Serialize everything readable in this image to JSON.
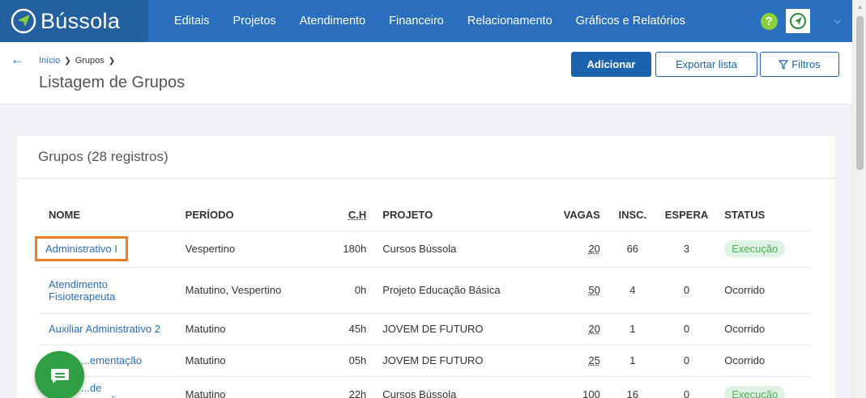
{
  "brand": {
    "name": "Bússola"
  },
  "nav": {
    "items": [
      "Editais",
      "Projetos",
      "Atendimento",
      "Financeiro",
      "Relacionamento",
      "Gráficos e Relatórios"
    ]
  },
  "header": {
    "breadcrumb": [
      "Início",
      "Grupos"
    ],
    "title": "Listagem de Grupos",
    "add_label": "Adicionar",
    "export_label": "Exportar lista",
    "filter_label": "Filtros"
  },
  "card": {
    "title": "Grupos (28 registros)"
  },
  "table": {
    "columns": [
      "NOME",
      "PERÍODO",
      "C.H",
      "PROJETO",
      "VAGAS",
      "INSC.",
      "ESPERA",
      "STATUS"
    ],
    "rows": [
      {
        "nome": "Administrativo I",
        "periodo": "Vespertino",
        "ch": "180h",
        "projeto": "Cursos Bússola",
        "vagas": "20",
        "insc": "66",
        "espera": "3",
        "status": "Execução"
      },
      {
        "nome": "Atendimento Fisioterapeuta",
        "periodo": "Matutino, Vespertino",
        "ch": "0h",
        "projeto": "Projeto Educação Básica",
        "vagas": "50",
        "insc": "4",
        "espera": "0",
        "status": "Ocorrido"
      },
      {
        "nome": "Auxiliar Administrativo 2",
        "periodo": "Matutino",
        "ch": "45h",
        "projeto": "JOVEM DE FUTURO",
        "vagas": "20",
        "insc": "1",
        "espera": "0",
        "status": "Ocorrido"
      },
      {
        "nome": "...ementação",
        "periodo": "Matutino",
        "ch": "05h",
        "projeto": "JOVEM DE FUTURO",
        "vagas": "25",
        "insc": "1",
        "espera": "0",
        "status": "Ocorrido"
      },
      {
        "nome": "...de aprendizagem",
        "periodo": "Matutino",
        "ch": "22h",
        "projeto": "Cursos Bússola",
        "vagas": "100",
        "insc": "16",
        "espera": "0",
        "status": "Execução"
      }
    ]
  },
  "colors": {
    "navbar": "#2a6fbe",
    "brand_bg": "#22609f",
    "primary": "#1b63ad",
    "highlight": "#f07d1f",
    "chat": "#2ea043",
    "status_exec": "#4caf50"
  },
  "icons": {
    "back": "arrow-left-icon",
    "help": "question-icon",
    "filter": "funnel-icon",
    "chat": "chat-icon"
  }
}
